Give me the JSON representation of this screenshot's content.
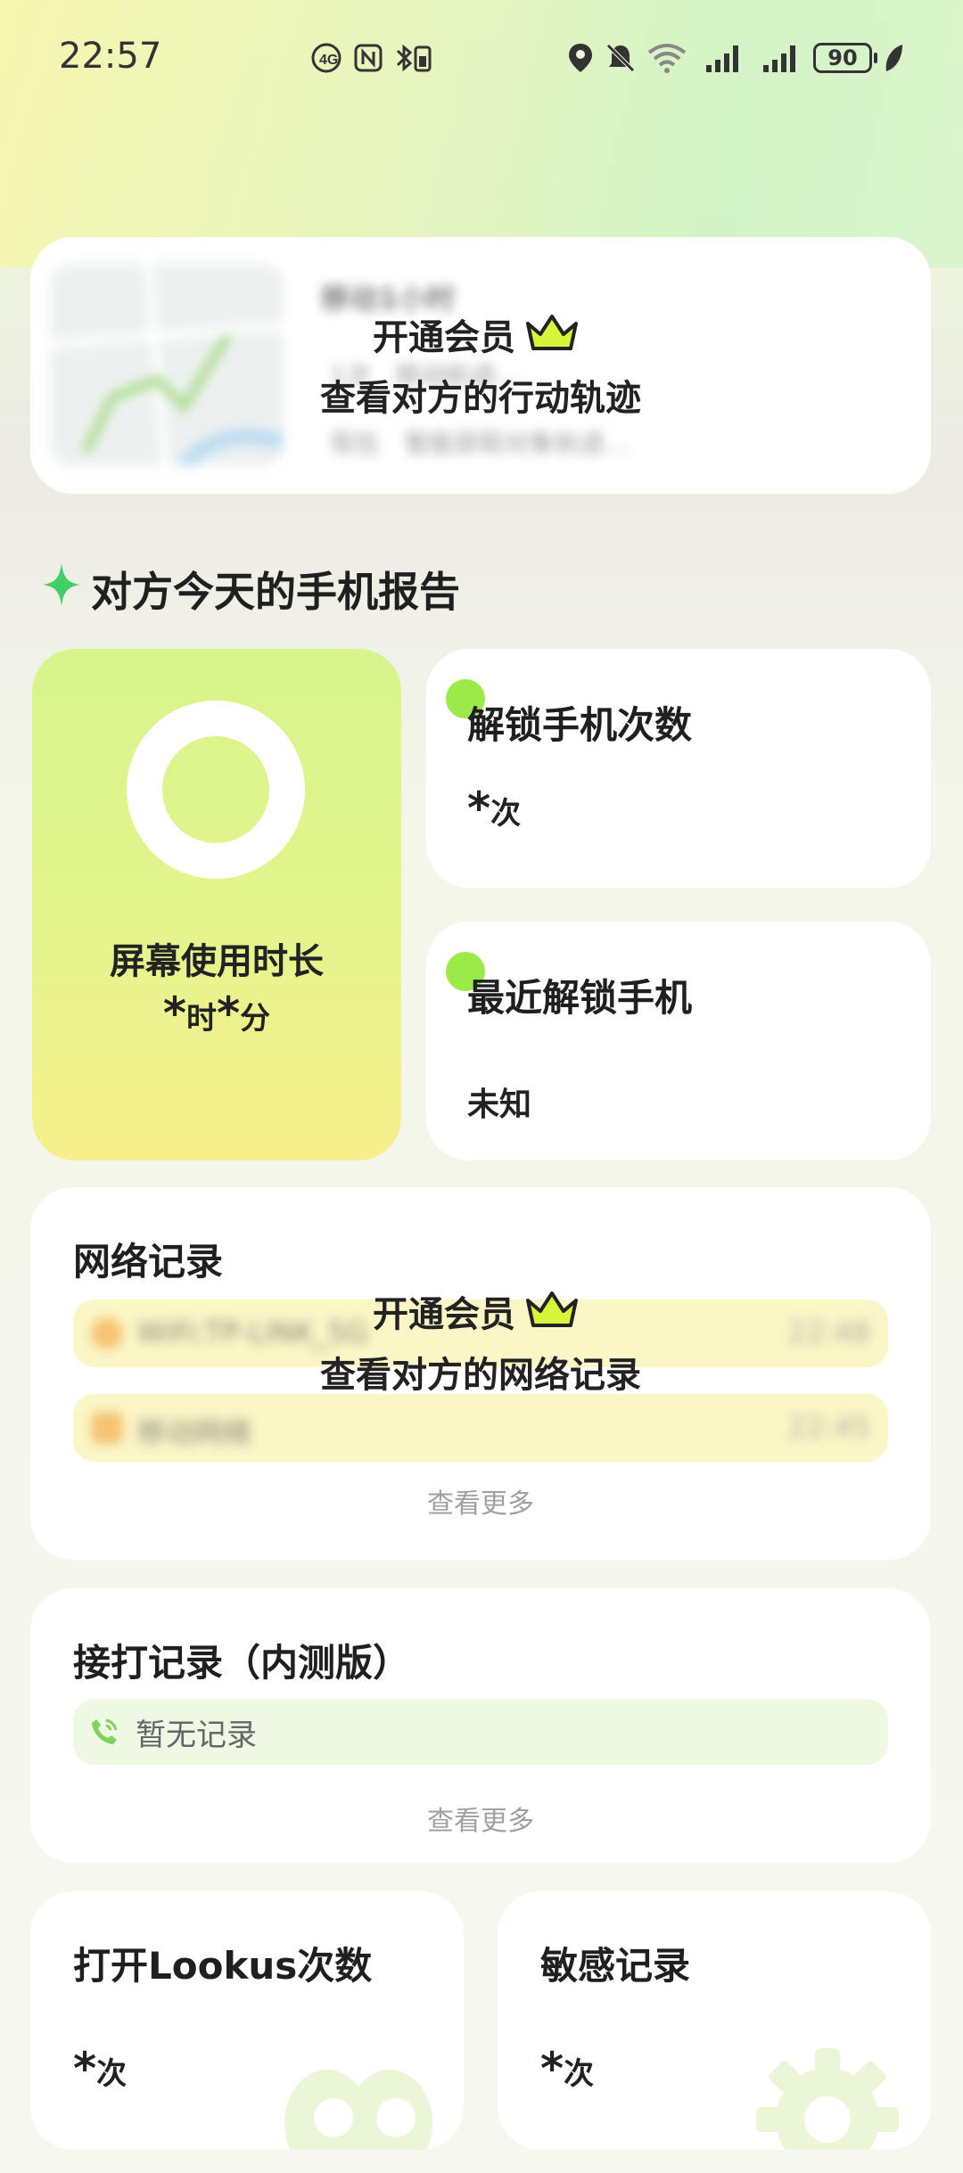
{
  "status_bar": {
    "time": "22:57",
    "battery": "90"
  },
  "track_card": {
    "blur_line1": "移动1小时",
    "blur_line2": "1次　移动轨迹…",
    "blur_line3": "现在　暂能获取对象轨迹…",
    "cta_title": "开通会员",
    "cta_subtitle": "查看对方的行动轨迹",
    "crown_icon": "crown-icon"
  },
  "report": {
    "title": "对方今天的手机报告",
    "sparkle_icon": "sparkle-icon",
    "screen_time": {
      "label": "屏幕使用时长",
      "hours_value": "*",
      "hours_unit": "时",
      "minutes_value": "*",
      "minutes_unit": "分"
    },
    "unlock_count": {
      "label": "解锁手机次数",
      "value": "*",
      "unit": "次"
    },
    "recent_unlock": {
      "label": "最近解锁手机",
      "value": "未知"
    }
  },
  "network": {
    "title": "网络记录",
    "rows": [
      {
        "name": "WiFi:TP-LINK_5G",
        "time": "22:48",
        "icon": "wifi-icon"
      },
      {
        "name": "移动网络",
        "time": "22:45",
        "icon": "signal-icon"
      }
    ],
    "cta_title": "开通会员",
    "cta_subtitle": "查看对方的网络记录",
    "more": "查看更多"
  },
  "calls": {
    "title": "接打记录（内测版）",
    "empty_text": "暂无记录",
    "icon": "phone-icon",
    "more": "查看更多"
  },
  "open_app": {
    "title": "打开Lookus次数",
    "value": "*",
    "unit": "次"
  },
  "sensitive": {
    "title": "敏感记录",
    "value": "*",
    "unit": "次"
  },
  "colors": {
    "accent": "#9bea4a",
    "screen_card_top": "#d6f58c",
    "screen_card_bottom": "#f7f08c"
  }
}
